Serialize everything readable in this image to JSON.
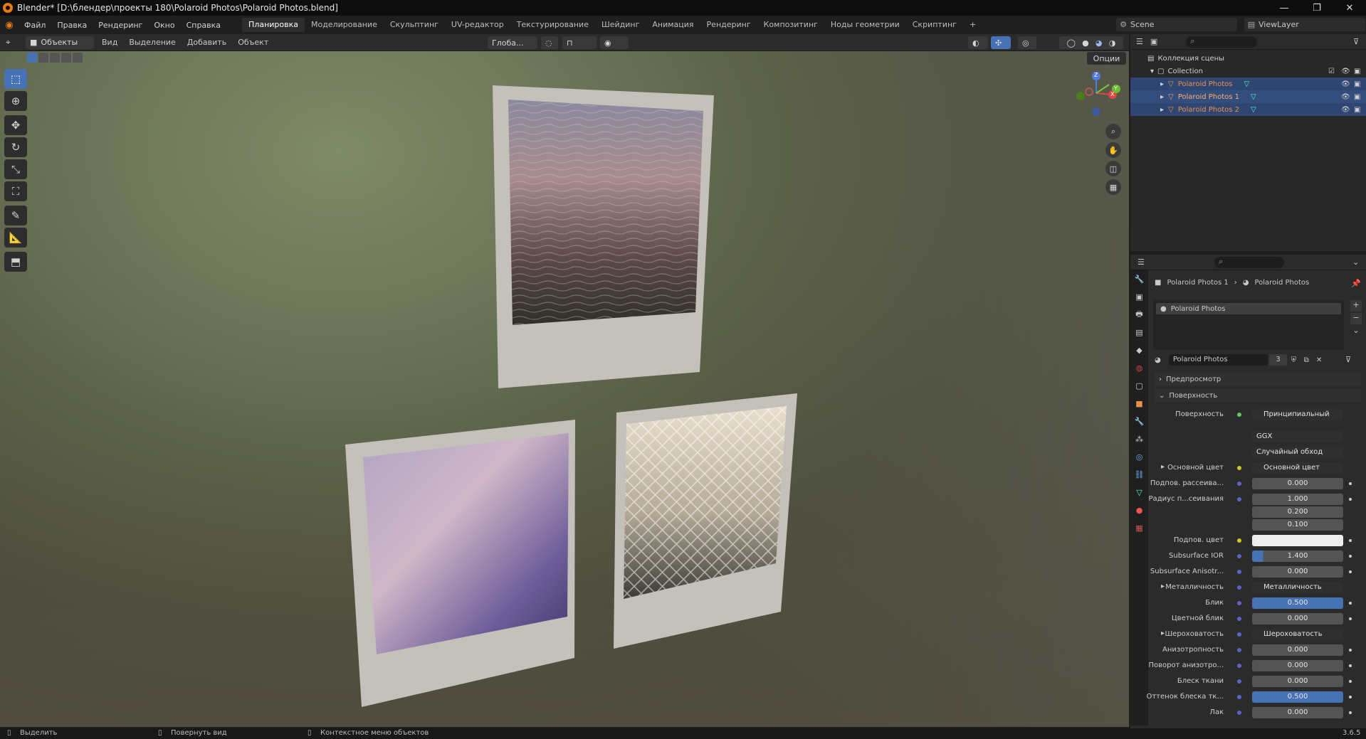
{
  "window": {
    "title": "Blender* [D:\\блендер\\проекты 180\\Polaroid Photos\\Polaroid Photos.blend]",
    "minimize": "—",
    "maximize": "❐",
    "close": "✕"
  },
  "menu": {
    "items": [
      "Файл",
      "Правка",
      "Рендеринг",
      "Окно",
      "Справка"
    ],
    "workspaces": [
      "Планировка",
      "Моделирование",
      "Скульптинг",
      "UV-редактор",
      "Текстурирование",
      "Шейдинг",
      "Анимация",
      "Рендеринг",
      "Композитинг",
      "Ноды геометрии",
      "Скриптинг"
    ],
    "add_workspace": "+",
    "scene": "Scene",
    "view_layer": "ViewLayer"
  },
  "viewport_header": {
    "mode": "Объекты",
    "menu": [
      "Вид",
      "Выделение",
      "Добавить",
      "Объект"
    ],
    "transform": "Глоба...",
    "options": "Опции"
  },
  "gizmo": {
    "x": "X",
    "y": "Y",
    "z": "Z"
  },
  "outliner": {
    "scene_collection": "Коллекция сцены",
    "collection": "Collection",
    "objects": [
      "Polaroid Photos",
      "Polaroid Photos 1",
      "Polaroid Photos 2"
    ]
  },
  "properties": {
    "breadcrumb_object": "Polaroid Photos 1",
    "breadcrumb_material": "Polaroid Photos",
    "slot": "Polaroid Photos",
    "material_name": "Polaroid Photos",
    "users": "3",
    "sections": {
      "preview": "Предпросмотр",
      "surface": "Поверхность"
    },
    "surface_label": "Поверхность",
    "surface_value": "Принципиальный BSDF",
    "distribution": "GGX",
    "subsurface_method": "Случайный обход",
    "rows": [
      {
        "label": "Основной цвет",
        "value": "Основной цвет",
        "kind": "link",
        "expand": true
      },
      {
        "label": "Подпов. рассеива...",
        "value": "0.000",
        "kind": "num"
      },
      {
        "label": "Радиус п...сеивания",
        "value": "1.000",
        "kind": "num"
      },
      {
        "label": "",
        "value": "0.200",
        "kind": "num"
      },
      {
        "label": "",
        "value": "0.100",
        "kind": "num"
      },
      {
        "label": "Подпов. цвет",
        "value": "",
        "kind": "color"
      },
      {
        "label": "Subsurface IOR",
        "value": "1.400",
        "kind": "numbar"
      },
      {
        "label": "Subsurface Anisotr...",
        "value": "0.000",
        "kind": "num"
      },
      {
        "label": "Металличность",
        "value": "Металличность",
        "kind": "link",
        "expand": true
      },
      {
        "label": "Блик",
        "value": "0.500",
        "kind": "blue"
      },
      {
        "label": "Цветной блик",
        "value": "0.000",
        "kind": "num"
      },
      {
        "label": "Шероховатость",
        "value": "Шероховатость",
        "kind": "link",
        "expand": true
      },
      {
        "label": "Анизотропность",
        "value": "0.000",
        "kind": "num"
      },
      {
        "label": "Поворот анизотро...",
        "value": "0.000",
        "kind": "num"
      },
      {
        "label": "Блеск ткани",
        "value": "0.000",
        "kind": "num"
      },
      {
        "label": "Оттенок блеска тк...",
        "value": "0.500",
        "kind": "blue"
      },
      {
        "label": "Лак",
        "value": "0.000",
        "kind": "num"
      }
    ]
  },
  "status": {
    "select": "Выделить",
    "rotate": "Повернуть вид",
    "context": "Контекстное меню объектов",
    "version": "3.6.5"
  },
  "colors": {
    "accent": "#4772b3",
    "orange": "#e87d0d",
    "selected_row": "#2f4672"
  }
}
